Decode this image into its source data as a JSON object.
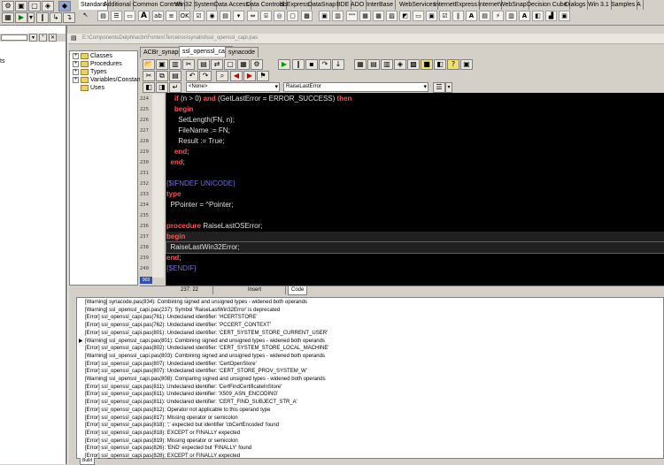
{
  "palette_tabs": [
    "Standard",
    "Additional",
    "Common Controls",
    "Win32",
    "System",
    "Data Access",
    "Data Controls",
    "dbExpress",
    "DataSnap",
    "BDE",
    "ADO",
    "InterBase",
    "WebServices",
    "InternetExpress",
    "Internet",
    "WebSnap",
    "Decision Cube",
    "Dialogs",
    "Win 3.1",
    "Samples",
    "A"
  ],
  "editor": {
    "file_path": "E:\\ComponentsDelphi\\acbr\\Fontes\\Terceiros\\synalist\\ssl_openssl_capi.pas",
    "tabs": [
      "ACBr_synapse",
      "ssl_openssl_capi",
      "synacode"
    ],
    "active_tab": 1,
    "combo_left": "<None>",
    "combo_right": "RaiseLastError",
    "status_position": "237: 22",
    "status_mode": "Insert",
    "status_tab": "Code",
    "gutter_bottom": "903"
  },
  "tree": [
    "Classes",
    "Procedures",
    "Types",
    "Variables/Constants",
    "Uses"
  ],
  "left_panel_fragment": "ts",
  "code_lines": [
    {
      "num": "224",
      "segments": [
        [
          "nm",
          "    "
        ],
        [
          "kw",
          "if"
        ],
        [
          "nm",
          " (n > 0) "
        ],
        [
          "kw",
          "and"
        ],
        [
          "nm",
          " (GetLastError = ERROR_SUCCESS) "
        ],
        [
          "kw",
          "then"
        ]
      ]
    },
    {
      "num": "225",
      "segments": [
        [
          "nm",
          "    "
        ],
        [
          "kw",
          "begin"
        ]
      ]
    },
    {
      "num": "226",
      "segments": [
        [
          "nm",
          "      SetLength(FN, n);"
        ]
      ]
    },
    {
      "num": "227",
      "segments": [
        [
          "nm",
          "      FileName := FN;"
        ]
      ]
    },
    {
      "num": "228",
      "segments": [
        [
          "nm",
          "      Result := True;"
        ]
      ]
    },
    {
      "num": "229",
      "segments": [
        [
          "nm",
          "    "
        ],
        [
          "kw",
          "end"
        ],
        [
          "nm",
          ";"
        ]
      ]
    },
    {
      "num": "230",
      "segments": [
        [
          "kw",
          "  end"
        ],
        [
          "nm",
          ";"
        ]
      ]
    },
    {
      "num": "231",
      "segments": [
        [
          "nm",
          ""
        ]
      ]
    },
    {
      "num": "232",
      "segments": [
        [
          "dir",
          "{$IFNDEF UNICODE}"
        ]
      ]
    },
    {
      "num": "233",
      "segments": [
        [
          "kw",
          "type"
        ]
      ]
    },
    {
      "num": "234",
      "segments": [
        [
          "nm",
          "  PPointer = ^Pointer;"
        ]
      ]
    },
    {
      "num": "235",
      "segments": [
        [
          "nm",
          ""
        ]
      ]
    },
    {
      "num": "236",
      "segments": [
        [
          "kw",
          "procedure"
        ],
        [
          "nm",
          " RaiseLastOSError;"
        ]
      ]
    },
    {
      "num": "237",
      "segments": [
        [
          "kw",
          "begin"
        ]
      ]
    },
    {
      "num": "238",
      "segments": [
        [
          "nm",
          "  RaiseLastWin32Error;"
        ]
      ]
    },
    {
      "num": "239",
      "segments": [
        [
          "kw",
          "end"
        ],
        [
          "nm",
          ";"
        ]
      ]
    },
    {
      "num": "240",
      "segments": [
        [
          "dir",
          "{$ENDIF}"
        ]
      ]
    }
  ],
  "messages": [
    "[Warning] synacode.pas(834): Combining signed and unsigned types - widened both operands",
    "[Warning] ssl_openssl_capi.pas(237): Symbol 'RaiseLastWin32Error' is deprecated",
    "[Error] ssl_openssl_capi.pas(761): Undeclared identifier: 'HCERTSTORE'",
    "[Error] ssl_openssl_capi.pas(762): Undeclared identifier: 'PCCERT_CONTEXT'",
    "[Error] ssl_openssl_capi.pas(801): Undeclared identifier: 'CERT_SYSTEM_STORE_CURRENT_USER'",
    "[Warning] ssl_openssl_capi.pas(801): Combining signed and unsigned types - widened both operands",
    "[Error] ssl_openssl_capi.pas(802): Undeclared identifier: 'CERT_SYSTEM_STORE_LOCAL_MACHINE'",
    "[Warning] ssl_openssl_capi.pas(803): Combining signed and unsigned types - widened both operands",
    "[Error] ssl_openssl_capi.pas(807): Undeclared identifier: 'CertOpenStore'",
    "[Error] ssl_openssl_capi.pas(807): Undeclared identifier: 'CERT_STORE_PROV_SYSTEM_W'",
    "[Warning] ssl_openssl_capi.pas(808): Comparing signed and unsigned types - widened both operands",
    "[Error] ssl_openssl_capi.pas(811): Undeclared identifier: 'CertFindCertificateInStore'",
    "[Error] ssl_openssl_capi.pas(811): Undeclared identifier: 'X509_ASN_ENCODING'",
    "[Error] ssl_openssl_capi.pas(811): Undeclared identifier: 'CERT_FIND_SUBJECT_STR_A'",
    "[Error] ssl_openssl_capi.pas(812): Operator not applicable to this operand type",
    "[Error] ssl_openssl_capi.pas(817): Missing operator or semicolon",
    "[Error] ssl_openssl_capi.pas(818): ';' expected but identifier 'cbCertEncoded' found",
    "[Error] ssl_openssl_capi.pas(818): EXCEPT or FINALLY expected",
    "[Error] ssl_openssl_capi.pas(819): Missing operator or semicolon",
    "[Error] ssl_openssl_capi.pas(826): 'END' expected but 'FINALLY' found",
    "[Error] ssl_openssl_capi.pas(828): EXCEPT or FINALLY expected"
  ],
  "messages_selected": 5,
  "bottom_tab": "Build",
  "colors": {
    "editor_bg": "#000000",
    "keyword": "#ff5050",
    "directive": "#7070e0",
    "current_line": "#202020"
  }
}
